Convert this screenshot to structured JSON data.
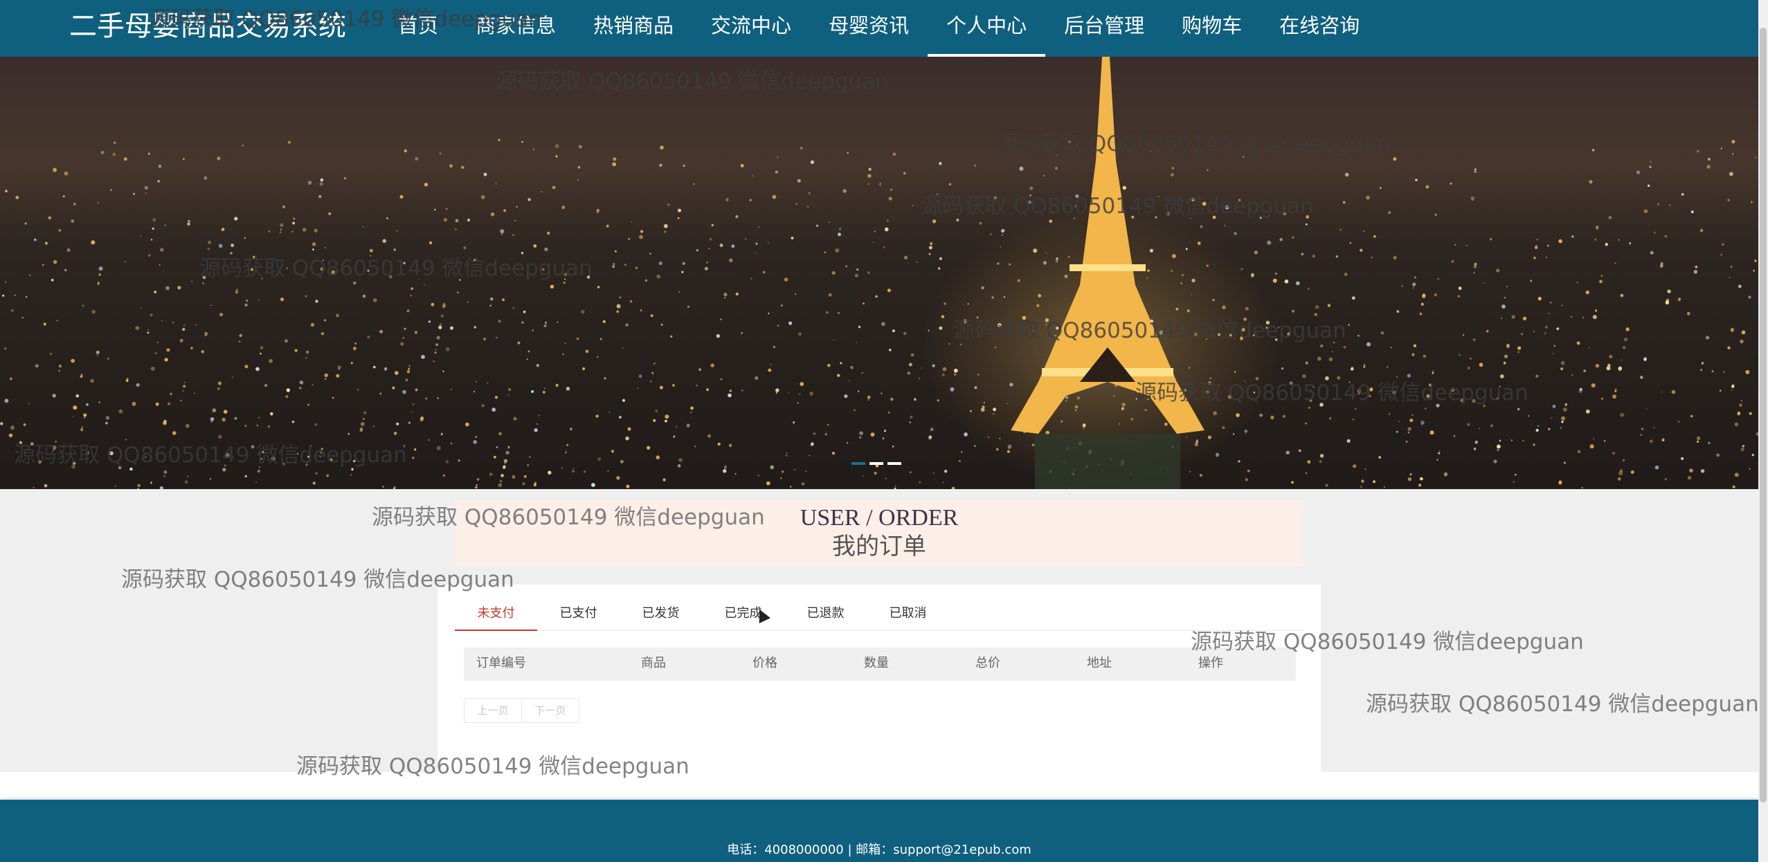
{
  "header": {
    "brand": "二手母婴商品交易系统",
    "nav": [
      "首页",
      "商家信息",
      "热销商品",
      "交流中心",
      "母婴资讯",
      "个人中心",
      "后台管理",
      "购物车",
      "在线咨询"
    ],
    "active_nav": "个人中心"
  },
  "banner": {
    "slides": 3,
    "active_slide": 1
  },
  "section": {
    "title_en": "USER / ORDER",
    "title_cn": "我的订单"
  },
  "orders": {
    "tabs": [
      "未支付",
      "已支付",
      "已发货",
      "已完成",
      "已退款",
      "已取消"
    ],
    "active_tab": "未支付",
    "columns": [
      "订单编号",
      "商品",
      "价格",
      "数量",
      "总价",
      "地址",
      "操作"
    ],
    "rows": [],
    "pager": {
      "prev": "上一页",
      "next": "下一页"
    }
  },
  "footer": {
    "contact": "电话：4008000000 | 邮箱：support@21epub.com"
  },
  "watermark": "源码获取 QQ86050149 微信deepguan",
  "colors": {
    "header_bg": "#0f5f7f",
    "accent_red": "#c0392b",
    "title_bg": "#fbefe8"
  }
}
